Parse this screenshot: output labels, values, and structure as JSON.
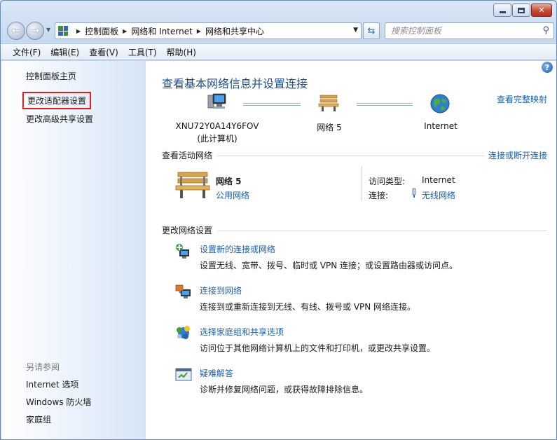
{
  "window": {
    "minimize_symbol": "▭",
    "maximize_symbol": "▢",
    "close_symbol": "✕"
  },
  "addressbar": {
    "crumbs": [
      "控制面板",
      "网络和 Internet",
      "网络和共享中心"
    ],
    "search_placeholder": "搜索控制面板"
  },
  "menubar": {
    "items": [
      "文件(F)",
      "编辑(E)",
      "查看(V)",
      "工具(T)",
      "帮助(H)"
    ]
  },
  "sidebar": {
    "home": "控制面板主页",
    "change_adapter": "更改适配器设置",
    "change_sharing": "更改高级共享设置",
    "see_also_header": "另请参阅",
    "see_also": [
      "Internet 选项",
      "Windows 防火墙",
      "家庭组"
    ]
  },
  "main": {
    "title": "查看基本网络信息并设置连接",
    "full_map_link": "查看完整映射",
    "computer_name": "XNU72Y0A14Y6FOV",
    "computer_sub": "(此计算机)",
    "network_node": "网络  5",
    "internet_node": "Internet",
    "active_header": "查看活动网络",
    "connect_link": "连接或断开连接",
    "active_network": {
      "name": "网络  5",
      "type": "公用网络",
      "access_label": "访问类型:",
      "access_value": "Internet",
      "connections_label": "连接:",
      "connections_value": "无线网络"
    },
    "change_header": "更改网络设置",
    "tasks": [
      {
        "icon": "new-connection-icon",
        "title": "设置新的连接或网络",
        "desc": "设置无线、宽带、拨号、临时或 VPN 连接；或设置路由器或访问点。"
      },
      {
        "icon": "connect-network-icon",
        "title": "连接到网络",
        "desc": "连接到或重新连接到无线、有线、拨号或 VPN 网络连接。"
      },
      {
        "icon": "homegroup-icon",
        "title": "选择家庭组和共享选项",
        "desc": "访问位于其他网络计算机上的文件和打印机，或更改共享设置。"
      },
      {
        "icon": "troubleshoot-icon",
        "title": "疑难解答",
        "desc": "诊断并修复网络问题，或获得故障排除信息。"
      }
    ]
  },
  "colors": {
    "link": "#1a5fb4",
    "title": "#1e4f8f",
    "highlight_box": "#e21f1f"
  }
}
